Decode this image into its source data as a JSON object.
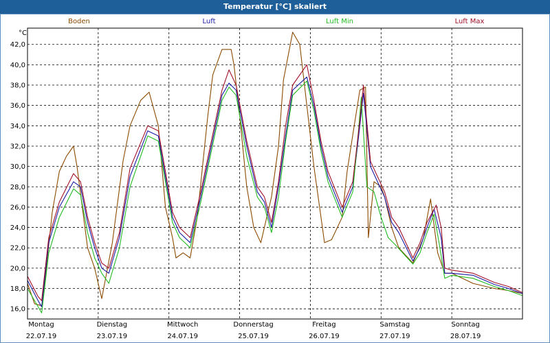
{
  "window": {
    "title": "Temperatur [°C] skaliert"
  },
  "chart_data": {
    "type": "line",
    "title": "Temperatur [°C] skaliert",
    "ylabel": "°C",
    "ylim": [
      15.0,
      43.6
    ],
    "xlim": [
      0,
      7
    ],
    "grid": true,
    "legend": "top",
    "yticks": [
      "16,0",
      "18,0",
      "20,0",
      "22,0",
      "24,0",
      "26,0",
      "28,0",
      "30,0",
      "32,0",
      "34,0",
      "36,0",
      "38,0",
      "40,0",
      "42,0"
    ],
    "ytick_values": [
      16,
      18,
      20,
      22,
      24,
      26,
      28,
      30,
      32,
      34,
      36,
      38,
      40,
      42
    ],
    "xticks": [
      {
        "day": "Montag",
        "date": "22.07.19"
      },
      {
        "day": "Dienstag",
        "date": "23.07.19"
      },
      {
        "day": "Mittwoch",
        "date": "24.07.19"
      },
      {
        "day": "Donnerstag",
        "date": "25.07.19"
      },
      {
        "day": "Freitag",
        "date": "26.07.19"
      },
      {
        "day": "Samstag",
        "date": "27.07.19"
      },
      {
        "day": "Sonntag",
        "date": "28.07.19"
      }
    ],
    "series": [
      {
        "name": "Boden",
        "color": "#8b4a00",
        "x": [
          0,
          0.1,
          0.2,
          0.22,
          0.35,
          0.45,
          0.55,
          0.65,
          0.7,
          0.85,
          0.95,
          1.05,
          1.2,
          1.35,
          1.45,
          1.6,
          1.72,
          1.85,
          1.95,
          2.05,
          2.1,
          2.2,
          2.3,
          2.4,
          2.55,
          2.62,
          2.75,
          2.88,
          2.92,
          3.0,
          3.1,
          3.2,
          3.3,
          3.4,
          3.45,
          3.55,
          3.62,
          3.75,
          3.85,
          3.95,
          4.05,
          4.15,
          4.2,
          4.3,
          4.45,
          4.52,
          4.62,
          4.7,
          4.78,
          4.82,
          4.9,
          5.0,
          5.05,
          5.15,
          5.25,
          5.45,
          5.6,
          5.7,
          5.8,
          5.9,
          6.0,
          6.3,
          6.6,
          6.8,
          7.0
        ],
        "y": [
          18.5,
          16.5,
          16.3,
          17.0,
          25.5,
          29.5,
          31.0,
          32.0,
          30.0,
          22.0,
          20.0,
          17.0,
          22.5,
          30.5,
          34.0,
          36.5,
          37.3,
          34.0,
          26.0,
          23.0,
          21.0,
          21.5,
          21.0,
          25.0,
          35.0,
          39.0,
          41.5,
          41.5,
          40.0,
          35.0,
          28.0,
          24.0,
          22.5,
          25.5,
          27.0,
          32.0,
          38.5,
          43.2,
          42.0,
          36.0,
          30.0,
          25.0,
          22.5,
          22.8,
          25.0,
          29.5,
          34.0,
          37.5,
          37.8,
          23.0,
          28.5,
          28.0,
          27.0,
          24.0,
          22.0,
          20.5,
          23.0,
          26.8,
          21.5,
          19.5,
          19.5,
          18.5,
          18.0,
          17.8,
          17.5
        ]
      },
      {
        "name": "Luft",
        "color": "#1a1aa6",
        "x": [
          0,
          0.15,
          0.2,
          0.3,
          0.45,
          0.65,
          0.75,
          0.85,
          0.95,
          1.05,
          1.15,
          1.3,
          1.45,
          1.7,
          1.85,
          1.95,
          2.05,
          2.15,
          2.3,
          2.45,
          2.75,
          2.85,
          2.95,
          3.1,
          3.25,
          3.35,
          3.45,
          3.55,
          3.65,
          3.75,
          3.95,
          4.05,
          4.15,
          4.25,
          4.45,
          4.6,
          4.7,
          4.75,
          4.85,
          4.95,
          5.05,
          5.15,
          5.25,
          5.45,
          5.55,
          5.65,
          5.75,
          5.85,
          5.9,
          6.0,
          6.3,
          6.6,
          6.8,
          7.0
        ],
        "y": [
          18.8,
          16.8,
          16.2,
          22.5,
          26.0,
          28.5,
          28.0,
          24.5,
          22.0,
          20.0,
          19.5,
          23.0,
          29.0,
          33.5,
          33.0,
          29.0,
          25.0,
          23.5,
          22.5,
          27.0,
          37.0,
          38.2,
          37.5,
          32.0,
          27.5,
          26.5,
          24.0,
          28.0,
          33.0,
          37.5,
          38.8,
          36.0,
          32.0,
          29.0,
          25.5,
          28.0,
          34.0,
          37.2,
          30.0,
          28.5,
          27.0,
          24.5,
          23.5,
          20.7,
          22.0,
          24.0,
          25.8,
          23.0,
          19.5,
          19.5,
          19.3,
          18.4,
          18.0,
          17.5
        ]
      },
      {
        "name": "Luft Min",
        "color": "#22bb22",
        "x": [
          0,
          0.2,
          0.3,
          0.45,
          0.65,
          0.75,
          0.85,
          0.95,
          1.05,
          1.15,
          1.3,
          1.45,
          1.7,
          1.85,
          1.95,
          2.05,
          2.15,
          2.3,
          2.45,
          2.75,
          2.85,
          2.95,
          3.1,
          3.25,
          3.35,
          3.45,
          3.55,
          3.65,
          3.75,
          3.95,
          4.05,
          4.15,
          4.25,
          4.45,
          4.6,
          4.68,
          4.72,
          4.8,
          4.9,
          5.0,
          5.1,
          5.2,
          5.45,
          5.55,
          5.65,
          5.75,
          5.82,
          5.9,
          6.0,
          6.3,
          6.6,
          6.8,
          7.0
        ],
        "y": [
          18.0,
          15.6,
          21.5,
          25.0,
          27.8,
          27.2,
          23.5,
          21.0,
          19.5,
          18.5,
          22.0,
          28.0,
          33.0,
          32.5,
          28.5,
          24.5,
          23.0,
          22.0,
          26.5,
          36.5,
          37.8,
          37.0,
          31.0,
          27.0,
          26.0,
          23.5,
          27.0,
          32.5,
          37.0,
          38.4,
          35.5,
          31.5,
          28.5,
          25.0,
          27.5,
          33.5,
          36.8,
          28.0,
          27.5,
          25.0,
          23.0,
          22.3,
          20.4,
          21.5,
          23.5,
          25.3,
          22.5,
          19.0,
          19.3,
          19.0,
          18.2,
          17.8,
          17.3
        ]
      },
      {
        "name": "Luft Max",
        "color": "#a01028",
        "x": [
          0,
          0.15,
          0.2,
          0.3,
          0.45,
          0.65,
          0.75,
          0.85,
          0.95,
          1.05,
          1.15,
          1.3,
          1.45,
          1.7,
          1.85,
          1.95,
          2.05,
          2.15,
          2.3,
          2.45,
          2.75,
          2.85,
          2.95,
          3.1,
          3.25,
          3.35,
          3.45,
          3.55,
          3.65,
          3.75,
          3.95,
          4.05,
          4.15,
          4.25,
          4.45,
          4.6,
          4.7,
          4.75,
          4.85,
          4.95,
          5.05,
          5.15,
          5.25,
          5.45,
          5.55,
          5.65,
          5.78,
          5.85,
          5.9,
          6.0,
          6.3,
          6.6,
          6.8,
          7.0
        ],
        "y": [
          19.2,
          17.2,
          16.8,
          23.0,
          26.5,
          29.3,
          28.5,
          25.0,
          22.5,
          20.5,
          20.0,
          23.5,
          29.8,
          34.0,
          33.5,
          29.5,
          25.5,
          24.0,
          23.0,
          27.5,
          37.5,
          39.5,
          38.0,
          32.5,
          28.0,
          27.0,
          24.5,
          28.5,
          34.0,
          38.0,
          40.0,
          36.5,
          32.5,
          29.5,
          26.0,
          28.5,
          34.5,
          38.0,
          30.5,
          29.0,
          27.5,
          25.0,
          24.0,
          21.0,
          22.5,
          24.5,
          26.2,
          24.0,
          20.0,
          19.8,
          19.5,
          18.6,
          18.2,
          17.6
        ]
      }
    ]
  }
}
